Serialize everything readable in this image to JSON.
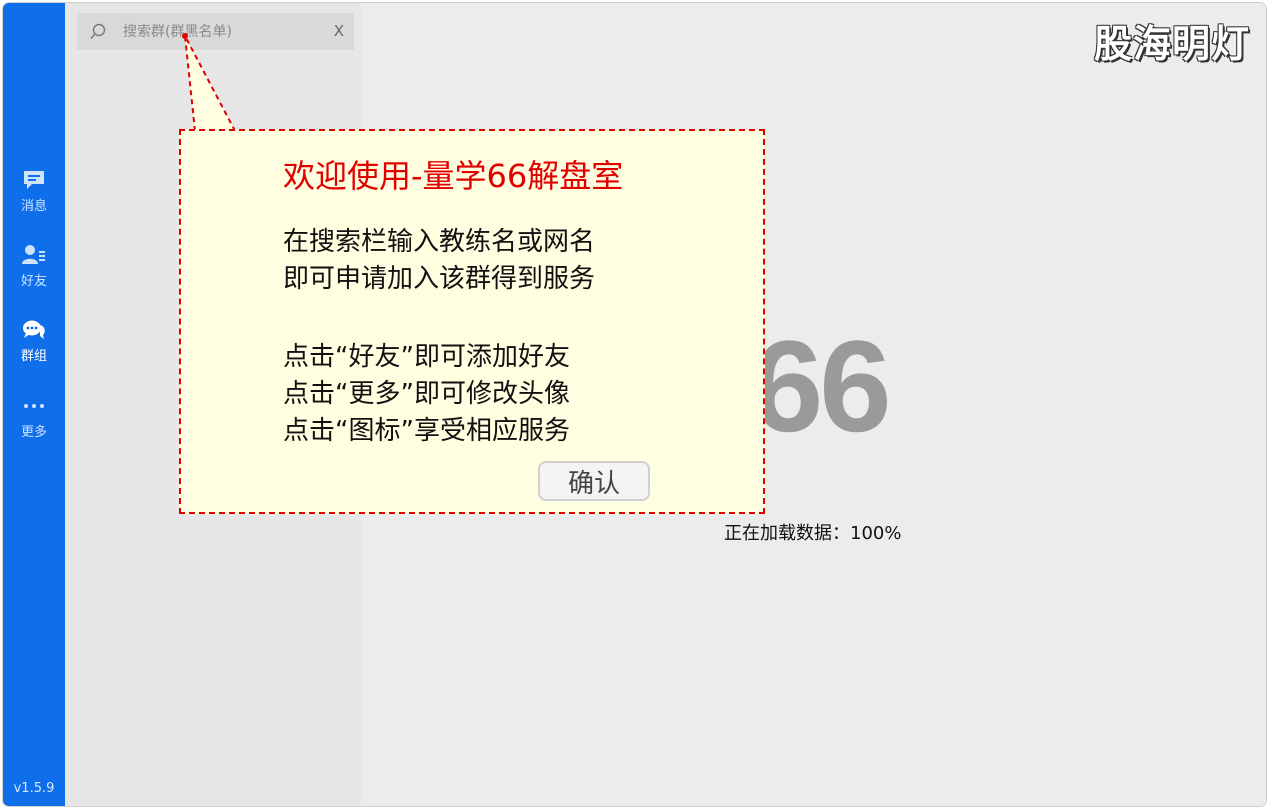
{
  "sidebar": {
    "items": [
      {
        "label": "消息",
        "icon": "message-icon"
      },
      {
        "label": "好友",
        "icon": "contacts-icon"
      },
      {
        "label": "群组",
        "icon": "group-chat-icon"
      },
      {
        "label": "更多",
        "icon": "more-dots-icon"
      }
    ],
    "active_item": "群组",
    "version": "v1.5.9"
  },
  "search": {
    "placeholder": "搜索群(群黑名单)",
    "clear_label": "X"
  },
  "main": {
    "logo_number": "66",
    "loading_text": "正在加载数据：100%"
  },
  "watermark": "股海明灯",
  "dialog": {
    "title": "欢迎使用-量学66解盘室",
    "lines": [
      "在搜索栏输入教练名或网名",
      "即可申请加入该群得到服务",
      "点击“好友”即可添加好友",
      "点击“更多”即可修改头像",
      "点击“图标”享受相应服务"
    ],
    "confirm_label": "确认"
  },
  "colors": {
    "sidebar": "#0f6fea",
    "dialog_border": "#e00000",
    "dialog_bg": "#fffee0",
    "dialog_title": "#e00000"
  }
}
